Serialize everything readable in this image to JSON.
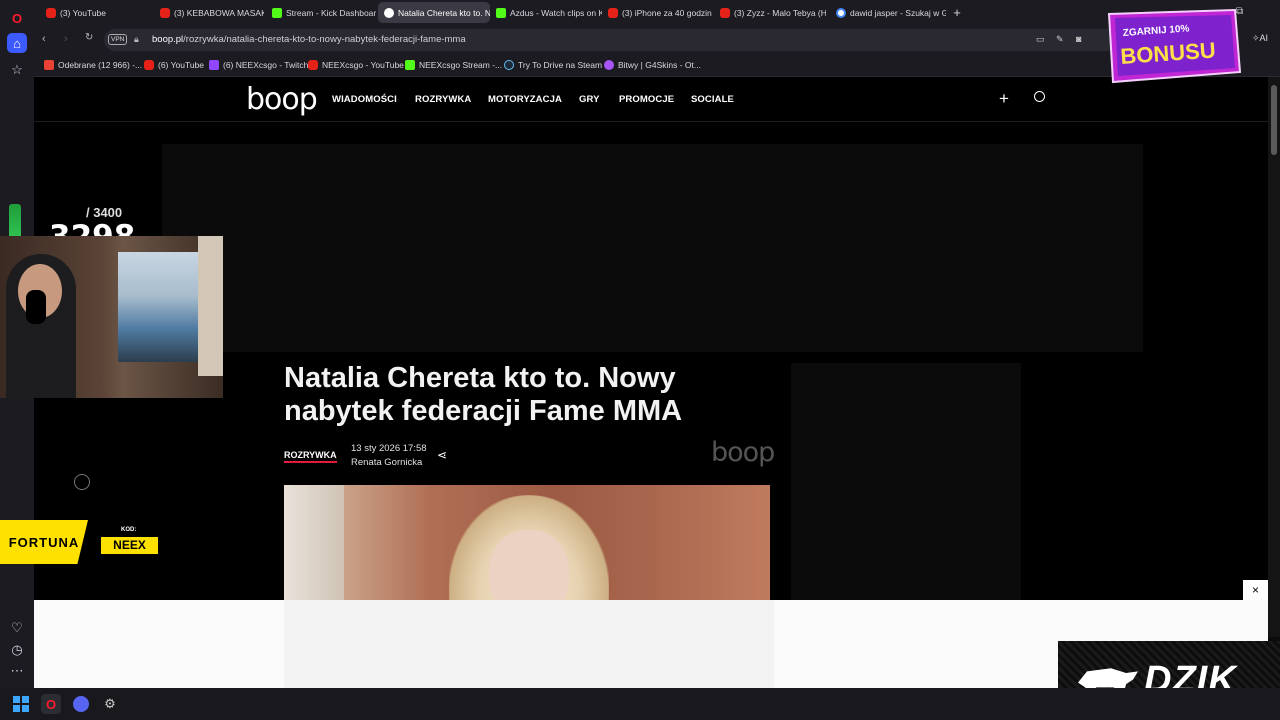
{
  "browser": {
    "tabs": [
      {
        "label": "(3) YouTube",
        "icon": "youtube-icon",
        "active": false
      },
      {
        "label": "(3) KEBABOWA MASAKRA",
        "icon": "youtube-icon",
        "active": false
      },
      {
        "label": "Stream - Kick Dashboard",
        "icon": "kick-icon",
        "active": false
      },
      {
        "label": "Natalia Chereta kto to. Nc",
        "icon": "boop-icon",
        "active": true
      },
      {
        "label": "Azdus - Watch clips on Ki",
        "icon": "kick-icon",
        "active": false
      },
      {
        "label": "(3) iPhone za 40 godzin st",
        "icon": "youtube-icon",
        "active": false
      },
      {
        "label": "(3) Zyzz - Malo Tebya (Ha",
        "icon": "youtube-icon",
        "active": false
      },
      {
        "label": "dawid jasper - Szukaj w G",
        "icon": "google-icon",
        "active": false
      }
    ],
    "new_tab": "+",
    "url_host": "boop.pl",
    "url_path": "/rozrywka/natalia-chereta-kto-to-nowy-nabytek-federacji-fame-mma",
    "vpn_label": "VPN",
    "ai_label": "AI",
    "bookmarks": [
      {
        "label": "Odebrane (12 966) -...",
        "icon": "gmail-icon"
      },
      {
        "label": "(6) YouTube",
        "icon": "youtube-icon"
      },
      {
        "label": "(6) NEEXcsgo - Twitch",
        "icon": "twitch-icon"
      },
      {
        "label": "NEEXcsgo - YouTube",
        "icon": "youtube-icon"
      },
      {
        "label": "NEEXcsgo Stream -...",
        "icon": "kick-icon"
      },
      {
        "label": "Try To Drive na Steam",
        "icon": "steam-icon"
      },
      {
        "label": "Bitwy | G4Skins - Ot...",
        "icon": "g4skins-icon"
      }
    ]
  },
  "site": {
    "logo": "boop",
    "nav": [
      "WIADOMOŚCI",
      "ROZRYWKA",
      "MOTORYZACJA",
      "GRY",
      "PROMOCJE",
      "SOCIALE"
    ],
    "article": {
      "title": "Natalia Chereta kto to. Nowy nabytek federacji Fame MMA",
      "category": "ROZRYWKA",
      "date": "13 sty 2026 17:58",
      "author": "Renata Gornicka",
      "watermark": "boop"
    }
  },
  "overlays": {
    "bonus_line1": "ZGARNIJ 10%",
    "bonus_line2": "BONUSU",
    "counter_max": "/ 3400",
    "counter_value": "3298",
    "fortuna": "FORTUNA",
    "kod_label": "KOD:",
    "kod_value": "NEEX",
    "dzik": "DZIK",
    "close_ad": "×"
  }
}
